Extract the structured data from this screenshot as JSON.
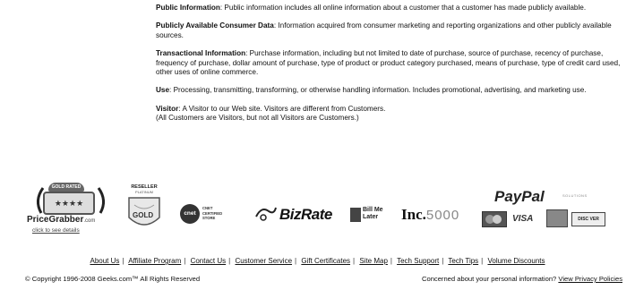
{
  "definitions": [
    {
      "term": "Public Information",
      "text": ": Public information includes all online information about a customer that a customer has made publicly available."
    },
    {
      "term": "Publicly Available Consumer Data",
      "text": ": Information acquired from consumer marketing and reporting organizations and other publicly available sources."
    },
    {
      "term": "Transactional Information",
      "text": ": Purchase information, including but not limited to date of purchase, source of purchase, recency of purchase, frequency of purchase, dollar amount of purchase, type of product or product category purchased, means of purchase, type of credit card used, other uses of online commerce."
    },
    {
      "term": "Use",
      "text": ": Processing, transmitting, transforming, or otherwise handling information. Includes promotional, advertising, and marketing use."
    },
    {
      "term": "Visitor",
      "text": ": A Visitor to our Web site. Visitors are different from Customers.",
      "extra": "(All Customers are Visitors, but not all Visitors are Customers.)"
    }
  ],
  "badges": {
    "pricegrabber": {
      "name": "PriceGrabber",
      "domain": ".com",
      "stars": "★★★★",
      "caption": "click to see details",
      "ribbon": "GOLD RATED"
    },
    "reseller": {
      "top": "RESELLER",
      "mid": "PLATINUM",
      "bottom": "GOLD"
    },
    "cnet": {
      "logo": "cnet",
      "text": "CNET CERTIFIED STORE"
    },
    "bizrate": {
      "text": "BizRate"
    },
    "billmelater": {
      "line1": "Bill Me",
      "line2": "Later"
    },
    "inc": {
      "text": "Inc.",
      "num": "5000"
    },
    "paypal": {
      "text": "PayPal",
      "small": "SOLUTIONS",
      "cards": [
        "VISA",
        "DISC VER"
      ]
    }
  },
  "links": [
    "About Us",
    "Affiliate Program",
    "Contact Us",
    "Customer Service",
    "Gift Certificates",
    "Site Map",
    "Tech Support",
    "Tech Tips",
    "Volume Discounts"
  ],
  "footer": {
    "copyright": "© Copyright 1996-2008 Geeks.com™ All Rights Reserved",
    "privacy_prefix": "Concerned about your personal information?",
    "privacy_link": "View Privacy Policies"
  }
}
